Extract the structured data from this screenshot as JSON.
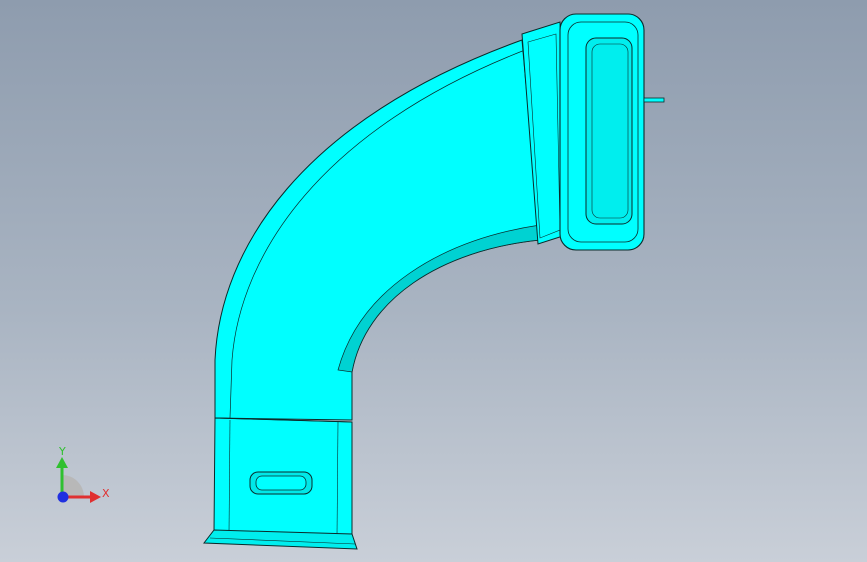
{
  "viewport": {
    "background_top": "#8e9cae",
    "background_bottom": "#c9cfd8"
  },
  "model": {
    "name": "elbow-duct",
    "face_color": "#00ffff",
    "edge_color": "#0a2b2b",
    "shade_color": "#00d6d6"
  },
  "triad": {
    "x_label": "X",
    "y_label": "Y",
    "x_color": "#e03030",
    "y_color": "#30c030",
    "z_color": "#2030e0"
  }
}
